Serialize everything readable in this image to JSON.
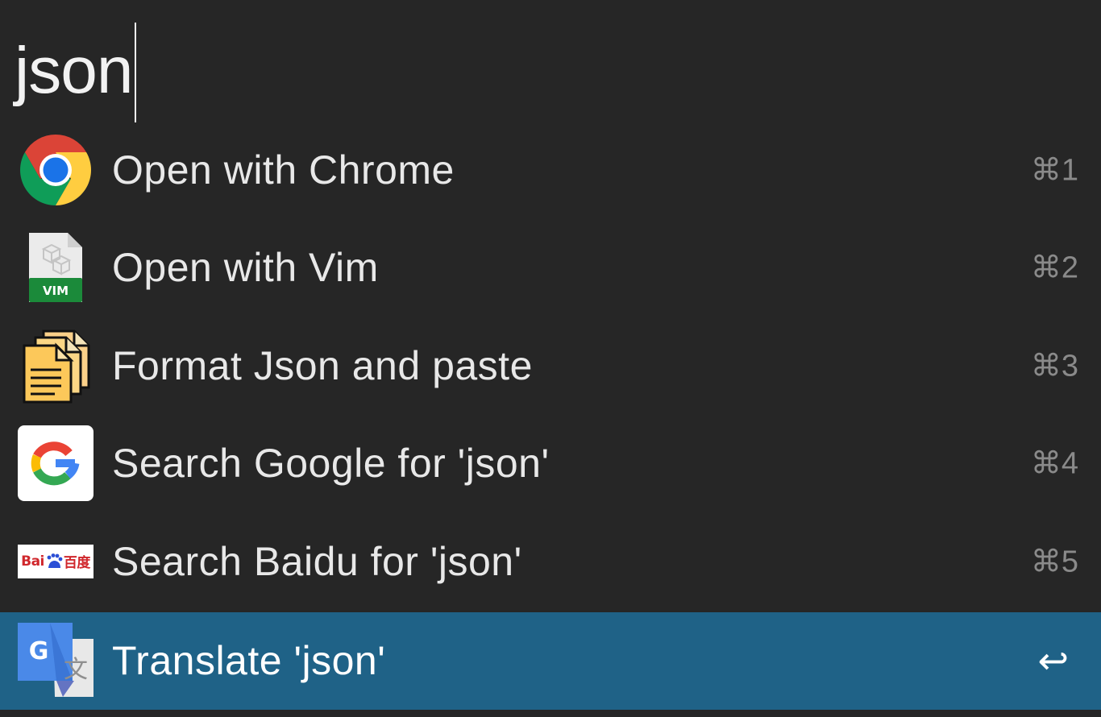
{
  "query": {
    "text": "json"
  },
  "results": [
    {
      "title": "Open with Chrome",
      "shortcut": "⌘1",
      "icon": "chrome-icon"
    },
    {
      "title": "Open with Vim",
      "shortcut": "⌘2",
      "icon": "vim-file-icon",
      "icon_label": "VIM"
    },
    {
      "title": "Format Json and paste",
      "shortcut": "⌘3",
      "icon": "paste-documents-icon"
    },
    {
      "title": "Search Google for 'json'",
      "shortcut": "⌘4",
      "icon": "google-icon"
    },
    {
      "title": "Search Baidu for 'json'",
      "shortcut": "⌘5",
      "icon": "baidu-icon",
      "icon_label_a": "Bai",
      "icon_label_b": "百度"
    },
    {
      "title": "Translate 'json'",
      "shortcut": "↩",
      "icon": "google-translate-icon",
      "selected": true
    }
  ],
  "colors": {
    "background": "#262626",
    "selected_row": "#1f6287",
    "title_text": "#e8e8e8",
    "shortcut_text": "#8a8a8a"
  }
}
